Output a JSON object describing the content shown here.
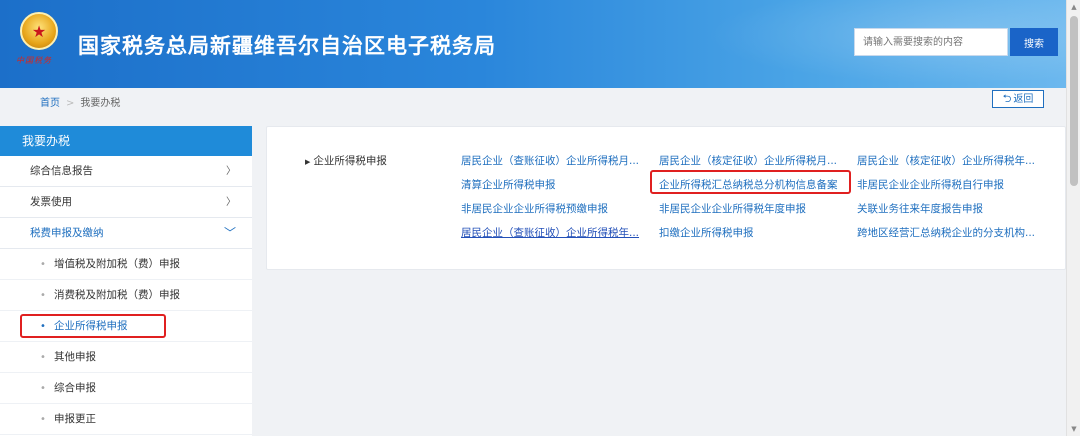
{
  "header": {
    "title": "国家税务总局新疆维吾尔自治区电子税务局",
    "emblem_motto": "中国税务",
    "search_placeholder": "请输入需要搜索的内容",
    "search_button": "搜索"
  },
  "breadcrumb": {
    "home": "首页",
    "current": "我要办税",
    "back_label": "返回"
  },
  "sidebar": {
    "title": "我要办税",
    "items": [
      {
        "label": "综合信息报告",
        "chevron": "〉"
      },
      {
        "label": "发票使用",
        "chevron": "〉"
      },
      {
        "label": "税费申报及缴纳",
        "chevron": "﹀",
        "open": true
      }
    ],
    "sub_items": [
      {
        "label": "增值税及附加税（费）申报"
      },
      {
        "label": "消费税及附加税（费）申报"
      },
      {
        "label": "企业所得税申报",
        "active": true
      },
      {
        "label": "其他申报"
      },
      {
        "label": "综合申报"
      },
      {
        "label": "申报更正"
      }
    ]
  },
  "content": {
    "category": "企业所得税申报",
    "links": [
      [
        "居民企业（查账征收）企业所得税月...",
        "居民企业（核定征收）企业所得税月...",
        "居民企业（核定征收）企业所得税年..."
      ],
      [
        "清算企业所得税申报",
        "企业所得税汇总纳税总分机构信息备案",
        "非居民企业企业所得税自行申报"
      ],
      [
        "非居民企业企业所得税预缴申报",
        "非居民企业企业所得税年度申报",
        "关联业务往来年度报告申报"
      ],
      [
        "居民企业（查账征收）企业所得税年...",
        "扣缴企业所得税申报",
        "跨地区经营汇总纳税企业的分支机构..."
      ]
    ]
  },
  "colors": {
    "header_blue": "#1c6fc9",
    "sidebar_head": "#1f8bd9",
    "link_blue": "#1f6fbf",
    "highlight_red": "#e02020"
  }
}
